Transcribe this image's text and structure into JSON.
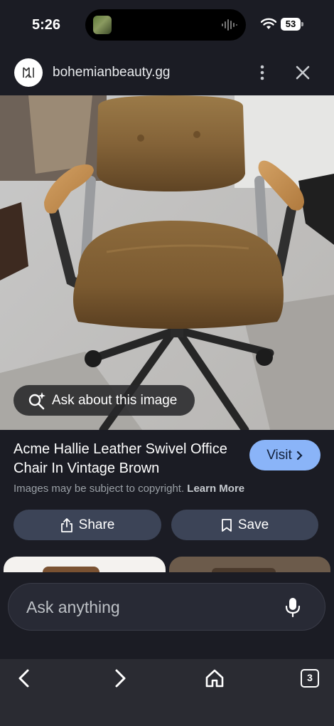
{
  "status_bar": {
    "time": "5:26",
    "battery": "53",
    "icons": [
      "now-playing-thumbnail",
      "audio-waveform-icon",
      "wifi-icon",
      "battery-icon"
    ]
  },
  "site": {
    "logo_text": "ꟾꟾ",
    "name": "bohemianbeauty.gg",
    "icons": [
      "more-vertical-icon",
      "close-icon"
    ]
  },
  "hero": {
    "ask_label": "Ask about this image",
    "icon": "lens-sparkle-icon"
  },
  "result": {
    "title": "Acme Hallie Leather Swivel Office Chair In Vintage Brown",
    "visit_label": "Visit",
    "copyright_text": "Images may be subject to copyright.",
    "learn_more": "Learn More"
  },
  "actions": {
    "share_label": "Share",
    "save_label": "Save"
  },
  "ask": {
    "placeholder": "Ask anything"
  },
  "nav": {
    "tab_count": "3",
    "icons": [
      "back-icon",
      "forward-icon",
      "home-icon",
      "tabs-icon"
    ]
  },
  "colors": {
    "background": "#1b1c24",
    "accent": "#8ab4f8",
    "button": "#3c4457",
    "nav": "#2a2b32"
  }
}
